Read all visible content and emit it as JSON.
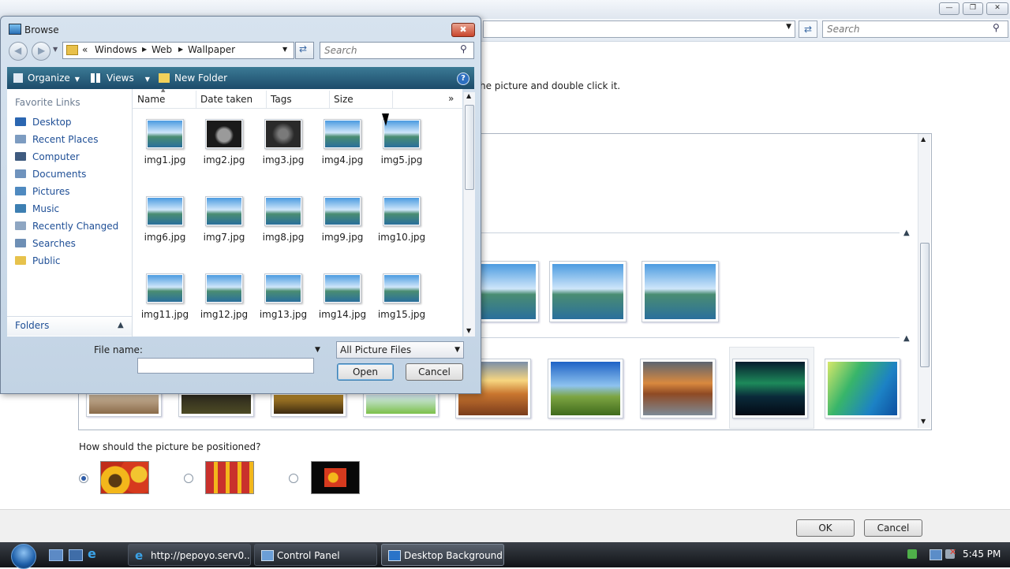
{
  "background_window": {
    "search_placeholder": "Search",
    "instruction_text": "he picture and double click it.",
    "position_question": "How should the picture be positioned?",
    "ok_label": "OK",
    "cancel_label": "Cancel"
  },
  "dialog": {
    "title": "Browse",
    "breadcrumb": {
      "prefix": "«",
      "items": [
        "Windows",
        "Web",
        "Wallpaper"
      ]
    },
    "search_placeholder": "Search",
    "toolbar": {
      "organize": "Organize",
      "views": "Views",
      "new_folder": "New Folder"
    },
    "favorite_links_label": "Favorite Links",
    "nav_items": [
      "Desktop",
      "Recent Places",
      "Computer",
      "Documents",
      "Pictures",
      "Music",
      "Recently Changed",
      "Searches",
      "Public"
    ],
    "folders_label": "Folders",
    "columns": [
      "Name",
      "Date taken",
      "Tags",
      "Size"
    ],
    "files": [
      "img1.jpg",
      "img2.jpg",
      "img3.jpg",
      "img4.jpg",
      "img5.jpg",
      "img6.jpg",
      "img7.jpg",
      "img8.jpg",
      "img9.jpg",
      "img10.jpg",
      "img11.jpg",
      "img12.jpg",
      "img13.jpg",
      "img14.jpg",
      "img15.jpg"
    ],
    "file_name_label": "File name:",
    "file_name_value": "",
    "filter_value": "All Picture Files",
    "open_label": "Open",
    "cancel_label": "Cancel"
  },
  "taskbar": {
    "tasks": [
      "http://pepoyo.serv0...",
      "Control Panel",
      "Desktop Background"
    ],
    "clock": "5:45 PM"
  },
  "colors": {
    "accent": "#1f4f96",
    "command_bar": "#2a5f7e",
    "taskbar": "#1b1f24"
  }
}
